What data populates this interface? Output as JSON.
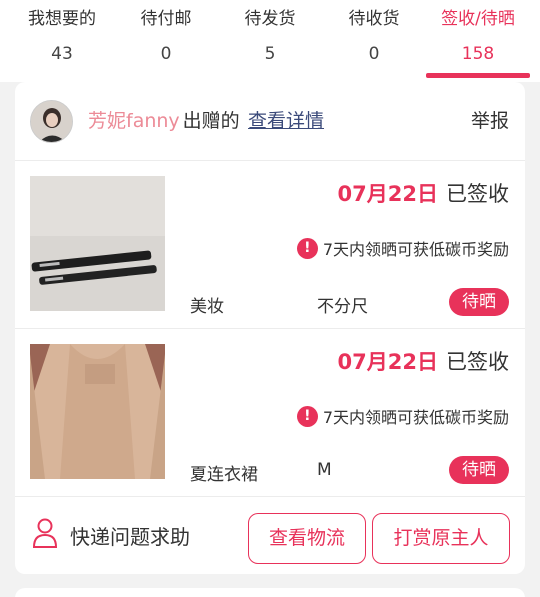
{
  "tabs": [
    {
      "label": "我想要的",
      "count": "43"
    },
    {
      "label": "待付邮",
      "count": "0"
    },
    {
      "label": "待发货",
      "count": "5"
    },
    {
      "label": "待收货",
      "count": "0"
    },
    {
      "label": "签收/待晒",
      "count": "158"
    }
  ],
  "active_tab": 4,
  "order": {
    "giver_name": "芳妮fanny",
    "giver_suffix": "出赠的",
    "view_detail": "查看详情",
    "report": "举报",
    "items": [
      {
        "date": "07月22日",
        "status": "已签收",
        "notice": "7天内领晒可获低碳币奖励",
        "category": "美妆",
        "size": "不分尺",
        "badge": "待晒"
      },
      {
        "date": "07月22日",
        "status": "已签收",
        "notice": "7天内领晒可获低碳币奖励",
        "category": "夏连衣裙",
        "size": "M",
        "badge": "待晒"
      }
    ],
    "help_text": "快递问题求助",
    "btn_logistics": "查看物流",
    "btn_reward": "打赏原主人"
  },
  "colors": {
    "accent": "#e8325a",
    "giver_name": "#ec8b97",
    "link": "#3b4a7a"
  },
  "icons": {
    "warning": "!",
    "help": "person-icon"
  }
}
